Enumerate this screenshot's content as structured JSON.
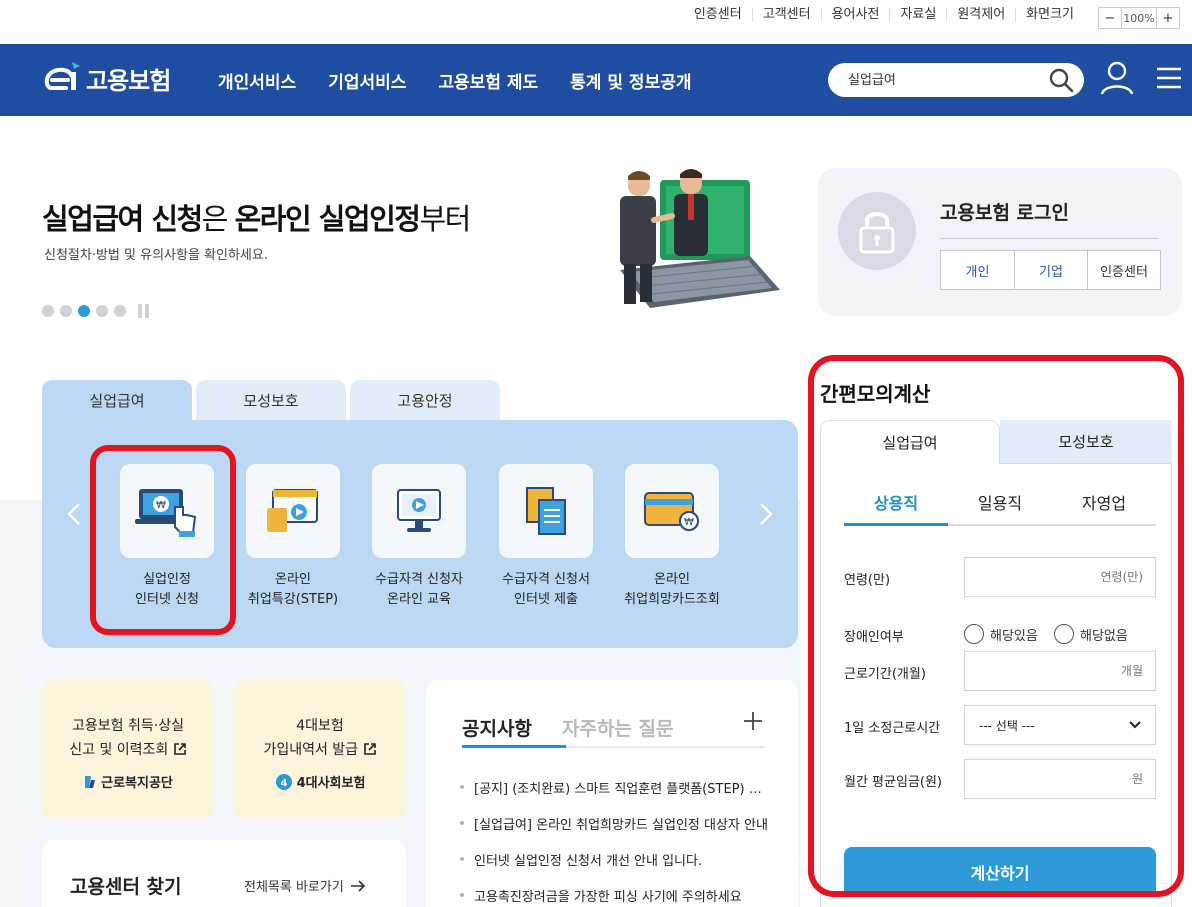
{
  "util": {
    "links": [
      "인증센터",
      "고객센터",
      "용어사전",
      "자료실",
      "원격제어",
      "화면크기"
    ],
    "zoom_minus": "−",
    "zoom_value": "100%",
    "zoom_plus": "+"
  },
  "nav": {
    "logo_text": "고용보험",
    "menu": [
      "개인서비스",
      "기업서비스",
      "고용보험 제도",
      "통계 및 정보공개"
    ],
    "search_value": "실업급여"
  },
  "hero": {
    "title_b1": "실업급여 신청",
    "title_t1": "은 ",
    "title_b2": "온라인 실업인정",
    "title_t2": "부터",
    "subtitle": "신청절차·방법 및 유의사항을 확인하세요.",
    "slide_count": 5,
    "active_slide": 3
  },
  "login": {
    "title": "고용보험 로그인",
    "buttons": [
      "개인",
      "기업",
      "인증센터"
    ]
  },
  "services": {
    "tabs": [
      "실업급여",
      "모성보호",
      "고용안정"
    ],
    "active_tab": 0,
    "items": [
      {
        "label": "실업인정\n인터넷 신청",
        "icon": "computer-hand-icon"
      },
      {
        "label": "온라인\n취업특강(STEP)",
        "icon": "video-lecture-icon"
      },
      {
        "label": "수급자격 신청자\n온라인 교육",
        "icon": "monitor-play-icon"
      },
      {
        "label": "수급자격 신청서\n인터넷 제출",
        "icon": "documents-icon"
      },
      {
        "label": "온라인\n취업희망카드조회",
        "icon": "card-won-icon"
      }
    ]
  },
  "cards": [
    {
      "text": "고용보험 취득·상실\n신고 및 이력조회",
      "org": "근로복지공단"
    },
    {
      "text": "4대보험\n가입내역서 발급",
      "org": "4대사회보험"
    }
  ],
  "center": {
    "title": "고용센터 찾기",
    "link": "전체목록 바로가기"
  },
  "notice": {
    "tab_active": "공지사항",
    "tab_inactive": "자주하는 질문",
    "items": [
      "[공지] (조치완료) 스마트 직업훈련 플랫폼(STEP) 접속 장애 안내",
      "[실업급여] 온라인 취업희망카드 실업인정 대상자 안내",
      "인터넷 실업인정 신청서 개선 안내 입니다.",
      "고용촉진장려금을 가장한 피싱 사기에 주의하세요"
    ]
  },
  "calc": {
    "title": "간편모의계산",
    "tabs": [
      "실업급여",
      "모성보호"
    ],
    "subtabs": [
      "상용직",
      "일용직",
      "자영업"
    ],
    "fields": {
      "age_label": "연령(만)",
      "age_placeholder": "연령(만)",
      "disability_label": "장애인여부",
      "disability_yes": "해당있음",
      "disability_no": "해당없음",
      "period_label": "근로기간(개월)",
      "period_placeholder": "개월",
      "hours_label": "1일 소정근로시간",
      "hours_selected": "--- 선택 ---",
      "wage_label": "월간 평균임금(원)",
      "wage_placeholder": "원"
    },
    "button": "계산하기"
  },
  "colors": {
    "nav_bg": "#1e4da1",
    "accent": "#2b9ad6",
    "highlight_red": "#e3141f"
  }
}
